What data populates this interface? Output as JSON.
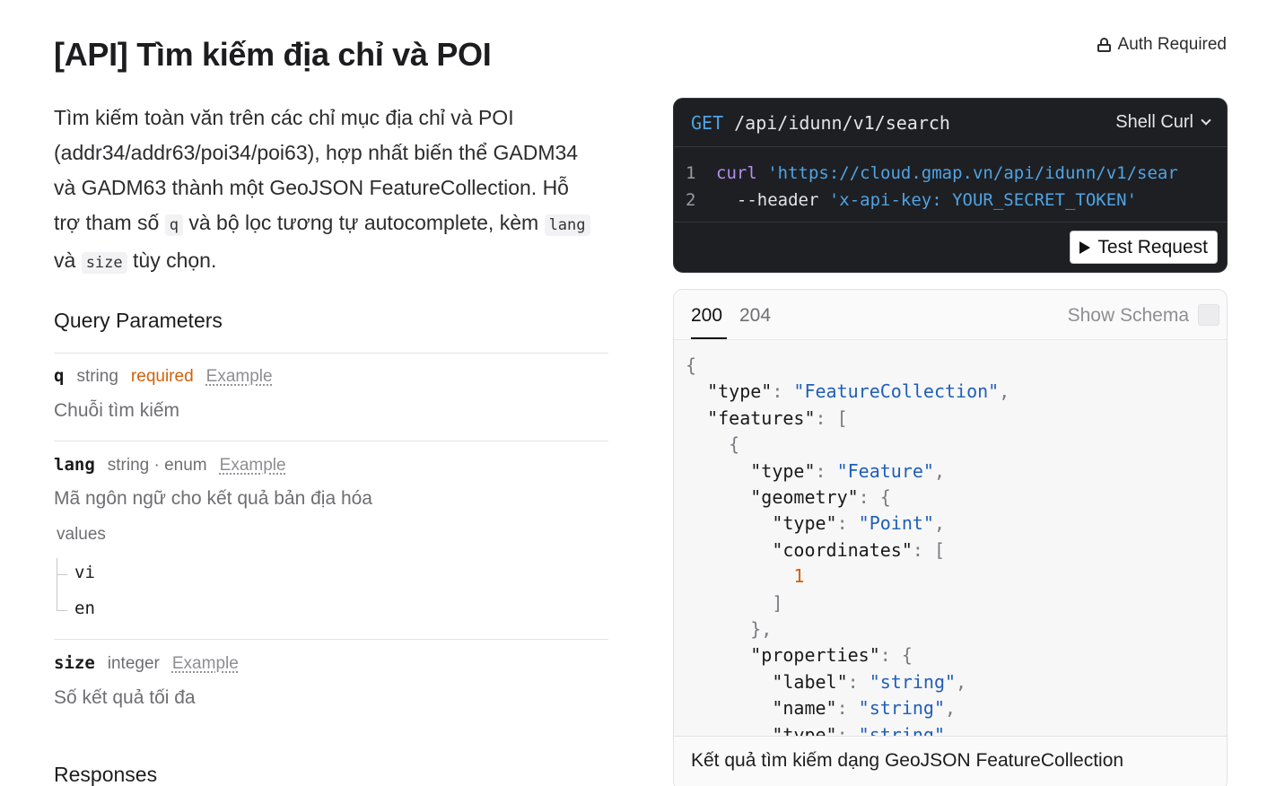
{
  "page": {
    "title": "[API] Tìm kiếm địa chỉ và POI",
    "auth_label": "Auth Required"
  },
  "description": {
    "part1": "Tìm kiếm toàn văn trên các chỉ mục địa chỉ và POI (addr34/addr63/poi34/poi63), hợp nhất biến thể GADM34 và GADM63 thành một GeoJSON FeatureCollection. Hỗ trợ tham số ",
    "code_q": "q",
    "part2": " và bộ lọc tương tự autocomplete, kèm ",
    "code_lang": "lang",
    "part3": " và ",
    "code_size": "size",
    "part4": " tùy chọn."
  },
  "query_parameters": {
    "title": "Query Parameters",
    "params": [
      {
        "name": "q",
        "type": "string",
        "required": "required",
        "example": "Example",
        "description": "Chuỗi tìm kiếm"
      },
      {
        "name": "lang",
        "type": "string · enum",
        "example": "Example",
        "description": "Mã ngôn ngữ cho kết quả bản địa hóa",
        "values_label": "values",
        "values": [
          "vi",
          "en"
        ]
      },
      {
        "name": "size",
        "type": "integer",
        "example": "Example",
        "description": "Số kết quả tối đa"
      }
    ]
  },
  "responses": {
    "title": "Responses"
  },
  "request_panel": {
    "method": "GET",
    "path": "/api/idunn/v1/search",
    "language": "Shell Curl",
    "lines": [
      {
        "no": "1",
        "cmd": "curl",
        "arg": "'https://cloud.gmap.vn/api/idunn/v1/sear"
      },
      {
        "no": "2",
        "cmd": "  --header",
        "arg": "'x-api-key: YOUR_SECRET_TOKEN'"
      }
    ],
    "test_button": "Test Request"
  },
  "response_panel": {
    "status_codes": [
      "200",
      "204"
    ],
    "selected_status": "200",
    "show_schema_label": "Show Schema",
    "json_example": [
      [
        [
          "p",
          "{"
        ]
      ],
      [
        [
          "k",
          "  \"type\""
        ],
        [
          "p",
          ": "
        ],
        [
          "s",
          "\"FeatureCollection\""
        ],
        [
          "p",
          ","
        ]
      ],
      [
        [
          "k",
          "  \"features\""
        ],
        [
          "p",
          ": ["
        ]
      ],
      [
        [
          "p",
          "    {"
        ]
      ],
      [
        [
          "k",
          "      \"type\""
        ],
        [
          "p",
          ": "
        ],
        [
          "s",
          "\"Feature\""
        ],
        [
          "p",
          ","
        ]
      ],
      [
        [
          "k",
          "      \"geometry\""
        ],
        [
          "p",
          ": {"
        ]
      ],
      [
        [
          "k",
          "        \"type\""
        ],
        [
          "p",
          ": "
        ],
        [
          "s",
          "\"Point\""
        ],
        [
          "p",
          ","
        ]
      ],
      [
        [
          "k",
          "        \"coordinates\""
        ],
        [
          "p",
          ": ["
        ]
      ],
      [
        [
          "n",
          "          1"
        ]
      ],
      [
        [
          "p",
          "        ]"
        ]
      ],
      [
        [
          "p",
          "      },"
        ]
      ],
      [
        [
          "k",
          "      \"properties\""
        ],
        [
          "p",
          ": {"
        ]
      ],
      [
        [
          "k",
          "        \"label\""
        ],
        [
          "p",
          ": "
        ],
        [
          "s",
          "\"string\""
        ],
        [
          "p",
          ","
        ]
      ],
      [
        [
          "k",
          "        \"name\""
        ],
        [
          "p",
          ": "
        ],
        [
          "s",
          "\"string\""
        ],
        [
          "p",
          ","
        ]
      ],
      [
        [
          "k",
          "        \"type\""
        ],
        [
          "p",
          ": "
        ],
        [
          "s",
          "\"string\""
        ],
        [
          "p",
          ","
        ]
      ]
    ],
    "footer_description": "Kết quả tìm kiếm dạng GeoJSON FeatureCollection"
  }
}
